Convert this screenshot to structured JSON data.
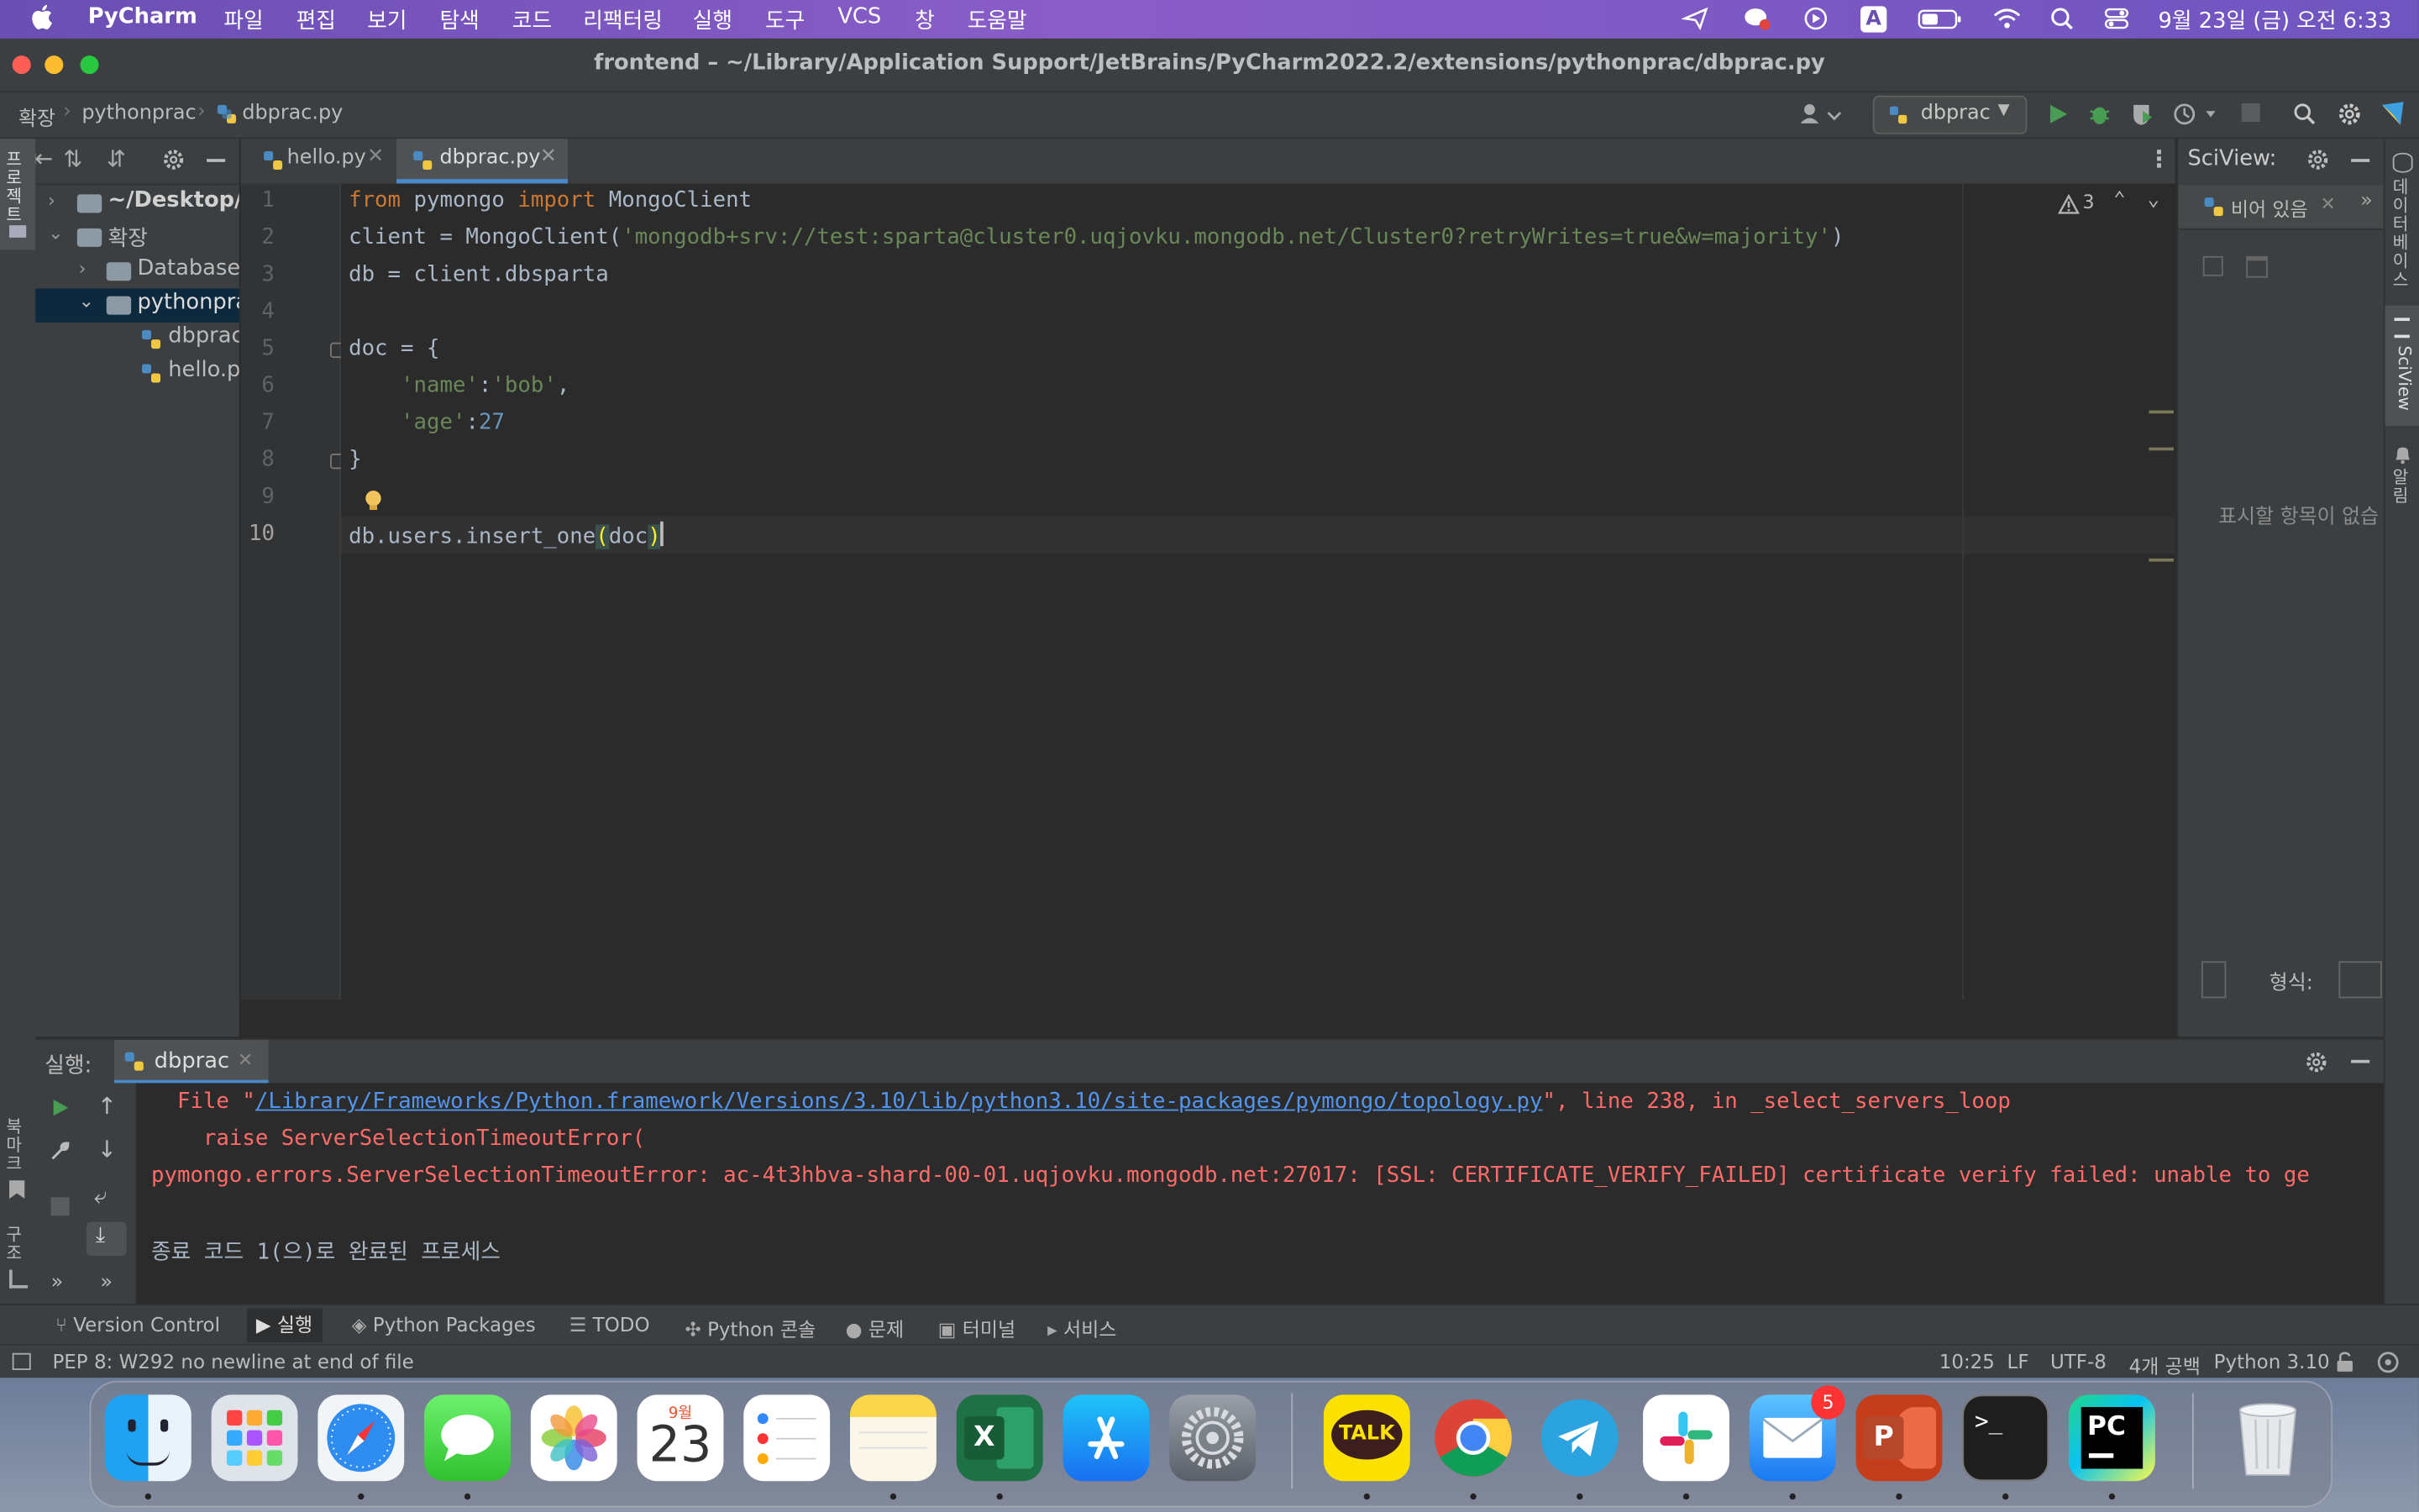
{
  "menubar": {
    "app": "PyCharm",
    "items": [
      "파일",
      "편집",
      "보기",
      "탐색",
      "코드",
      "리팩터링",
      "실행",
      "도구",
      "VCS",
      "창",
      "도움말"
    ],
    "clock": "9월 23일 (금) 오전 6:33",
    "input_mode": "A"
  },
  "window": {
    "title": "frontend – ~/Library/Application Support/JetBrains/PyCharm2022.2/extensions/pythonprac/dbprac.py"
  },
  "breadcrumb": [
    "확장",
    "pythonprac",
    "dbprac.py"
  ],
  "run_config": "dbprac",
  "project_tree": [
    {
      "label": "~/Desktop/s",
      "type": "folder",
      "expanded": false
    },
    {
      "label": "확장",
      "type": "folder",
      "expanded": true
    },
    {
      "label": "Database",
      "type": "folder",
      "expanded": false
    },
    {
      "label": "pythonpra",
      "type": "folder",
      "expanded": true,
      "selected": true
    },
    {
      "label": "dbprac",
      "type": "file"
    },
    {
      "label": "hello.py",
      "type": "file"
    }
  ],
  "tool_labels": {
    "project": "프로젝트",
    "bookmarks": "북마크",
    "structure": "구조",
    "database": "데이터베이스",
    "sciview": "SciView",
    "notifications": "알림"
  },
  "editor_tabs": [
    {
      "label": "hello.py",
      "active": false
    },
    {
      "label": "dbprac.py",
      "active": true
    }
  ],
  "editor": {
    "warnings": "3",
    "line_numbers": [
      "1",
      "2",
      "3",
      "4",
      "5",
      "6",
      "7",
      "8",
      "9",
      "10"
    ],
    "code": [
      "from pymongo import MongoClient",
      "client = MongoClient('mongodb+srv://test:sparta@cluster0.uqjovku.mongodb.net/Cluster0?retryWrites=true&w=majority')",
      "db = client.dbsparta",
      "",
      "doc = {",
      "    'name':'bob',",
      "    'age':27",
      "}",
      "",
      "db.users.insert_one(doc)"
    ]
  },
  "sciview": {
    "title": "SciView:",
    "tab": "비어 있음",
    "empty": "표시할 항목이 없습",
    "format_label": "형식:"
  },
  "run_panel": {
    "label": "실행:",
    "tab": "dbprac",
    "console": [
      {
        "pre": "  File \"",
        "link": "/Library/Frameworks/Python.framework/Versions/3.10/lib/python3.10/site-packages/pymongo/topology.py",
        "post": "\", line 238, in _select_servers_loop",
        "kind": "error"
      },
      {
        "text": "    raise ServerSelectionTimeoutError(",
        "kind": "error"
      },
      {
        "text": "pymongo.errors.ServerSelectionTimeoutError: ac-4t3hbva-shard-00-01.uqjovku.mongodb.net:27017: [SSL: CERTIFICATE_VERIFY_FAILED] certificate verify failed: unable to ge",
        "kind": "error"
      },
      {
        "text": "",
        "kind": "normal"
      },
      {
        "text": "종료 코드 1(으)로 완료된 프로세스",
        "kind": "normal"
      }
    ]
  },
  "bottom_tabs": [
    "Version Control",
    "실행",
    "Python Packages",
    "TODO",
    "Python 콘솔",
    "문제",
    "터미널",
    "서비스"
  ],
  "status": {
    "message": "PEP 8: W292 no newline at end of file",
    "position": "10:25",
    "line_sep": "LF",
    "encoding": "UTF-8",
    "indent": "4개 공백",
    "interpreter": "Python 3.10"
  },
  "dock": {
    "calendar_month": "9월",
    "calendar_day": "23",
    "kakao_label": "TALK",
    "mail_badge": "5",
    "pycharm_label": "PC",
    "apps": [
      "finder",
      "launchpad",
      "safari",
      "messages",
      "photos",
      "calendar",
      "reminders",
      "notes",
      "excel",
      "app-store",
      "system-preferences",
      "kakaotalk",
      "chrome",
      "telegram",
      "slack",
      "mail",
      "powerpoint",
      "terminal",
      "pycharm",
      "trash"
    ]
  },
  "colors": {
    "keyword": "#cc7832",
    "string": "#6a8759",
    "number": "#6897bb",
    "text": "#a9b7c6",
    "error": "#ff6b68",
    "link": "#5394ec",
    "selection": "#0d293e",
    "accent": "#4a88c7"
  }
}
